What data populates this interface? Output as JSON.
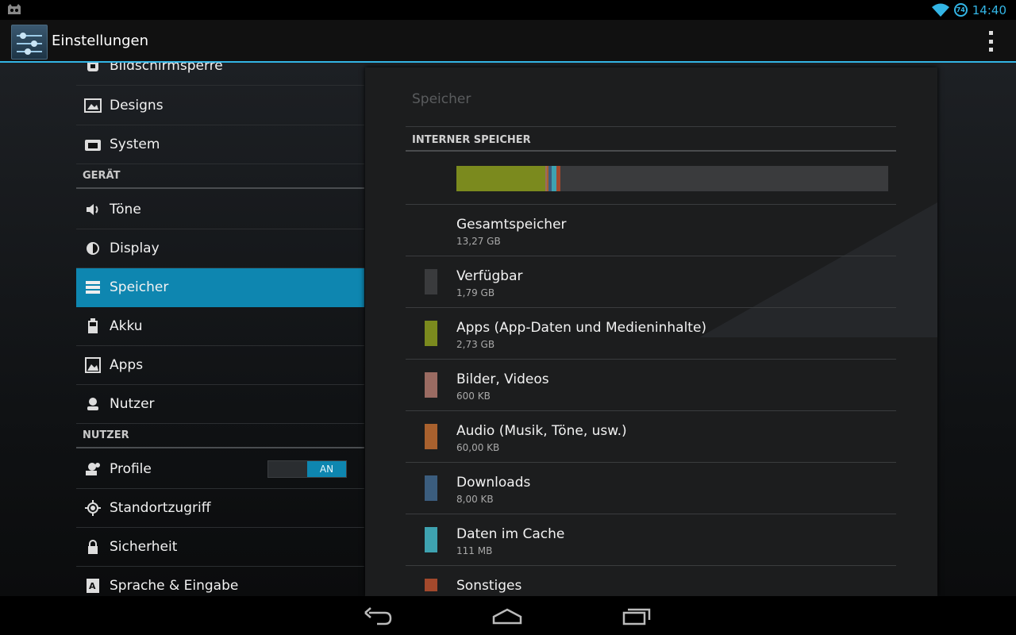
{
  "status": {
    "time": "14:40",
    "battery_level": "74"
  },
  "actionbar": {
    "title": "Einstellungen"
  },
  "left_list": {
    "items": [
      {
        "label": "Bildschirmsperre",
        "icon": "lock-screen-icon"
      },
      {
        "label": "Designs",
        "icon": "themes-icon"
      },
      {
        "label": "System",
        "icon": "system-icon"
      },
      {
        "section": "GERÄT"
      },
      {
        "label": "Töne",
        "icon": "volume-icon"
      },
      {
        "label": "Display",
        "icon": "brightness-icon"
      },
      {
        "label": "Speicher",
        "icon": "storage-icon",
        "active": true
      },
      {
        "label": "Akku",
        "icon": "battery-icon"
      },
      {
        "label": "Apps",
        "icon": "apps-icon"
      },
      {
        "label": "Nutzer",
        "icon": "user-icon"
      },
      {
        "section": "NUTZER"
      },
      {
        "label": "Profile",
        "icon": "profiles-icon",
        "toggle": "AN"
      },
      {
        "label": "Standortzugriff",
        "icon": "location-icon"
      },
      {
        "label": "Sicherheit",
        "icon": "security-icon"
      },
      {
        "label": "Sprache & Eingabe",
        "icon": "language-icon"
      }
    ]
  },
  "storage": {
    "title": "Speicher",
    "header": "INTERNER SPEICHER",
    "items": [
      {
        "name": "Gesamtspeicher",
        "size": "13,27 GB",
        "color": ""
      },
      {
        "name": "Verfügbar",
        "size": "1,79 GB",
        "color": "#3a3b3d"
      },
      {
        "name": "Apps (App-Daten und Medieninhalte)",
        "size": "2,73 GB",
        "color": "#7b8a1e"
      },
      {
        "name": "Bilder, Videos",
        "size": "600 KB",
        "color": "#9a6b62"
      },
      {
        "name": "Audio (Musik, Töne, usw.)",
        "size": "60,00 KB",
        "color": "#a9612e"
      },
      {
        "name": "Downloads",
        "size": "8,00 KB",
        "color": "#3b5d7e"
      },
      {
        "name": "Daten im Cache",
        "size": "111 MB",
        "color": "#3ea2b0"
      },
      {
        "name": "Sonstiges",
        "size": "",
        "color": "#a3492c"
      }
    ],
    "usage_segments": [
      {
        "color": "#7b8a1e",
        "fraction": 0.206
      },
      {
        "color": "#9a6b62",
        "fraction": 0.004
      },
      {
        "color": "#a9612e",
        "fraction": 0.004
      },
      {
        "color": "#3b5d7e",
        "fraction": 0.006
      },
      {
        "color": "#3ea2b0",
        "fraction": 0.011
      },
      {
        "color": "#a3492c",
        "fraction": 0.01
      }
    ]
  }
}
